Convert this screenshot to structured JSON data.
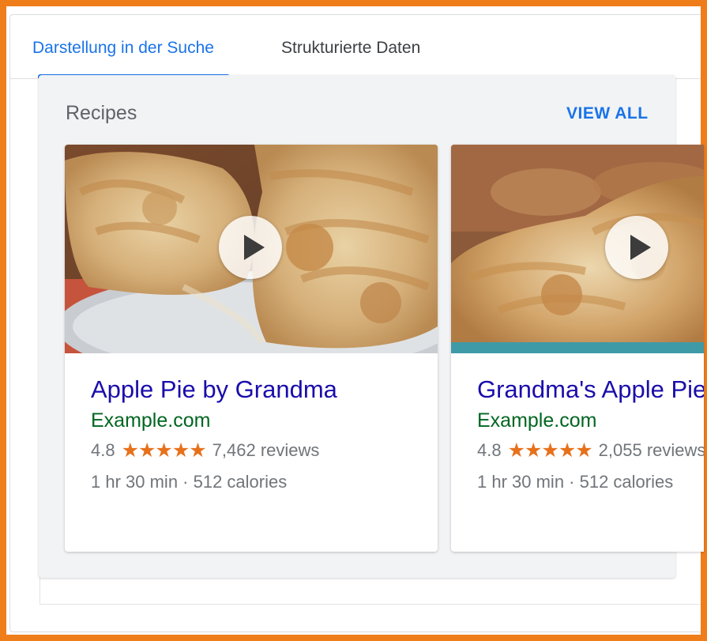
{
  "tabs": [
    {
      "label": "Darstellung in der Suche",
      "active": true
    },
    {
      "label": "Strukturierte Daten",
      "active": false
    }
  ],
  "section": {
    "title": "Recipes",
    "view_all": "VIEW ALL"
  },
  "cards": [
    {
      "title": "Apple Pie by Grandma",
      "site": "Example.com",
      "rating": "4.8",
      "stars": "★★★★★",
      "reviews": "7,462 reviews",
      "meta": "1 hr 30 min · 512 calories",
      "media_icon": "play-icon"
    },
    {
      "title": "Grandma's Apple Pie",
      "site": "Example.com",
      "rating": "4.8",
      "stars": "★★★★★",
      "reviews": "2,055 reviews",
      "meta": "1 hr 30 min · 512 calories",
      "media_icon": "play-icon"
    }
  ],
  "colors": {
    "frame_border": "#ef7d1a",
    "tab_active": "#1a73e8",
    "link_title": "#1a0dab",
    "site_url": "#006621",
    "star": "#e7711b",
    "muted_text": "#70757a"
  }
}
